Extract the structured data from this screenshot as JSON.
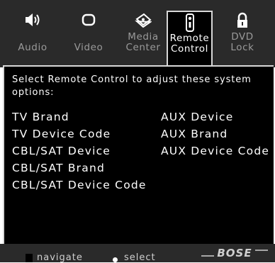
{
  "tabs": [
    {
      "label": "Audio",
      "icon": "speaker-icon",
      "active": false
    },
    {
      "label": "Video",
      "icon": "tv-screen-icon",
      "active": false
    },
    {
      "label": "Media\nCenter",
      "icon": "media-disc-icon",
      "active": false
    },
    {
      "label": "Remote\nControl",
      "icon": "remote-control-icon",
      "active": true
    },
    {
      "label": "DVD\nLock",
      "icon": "padlock-icon",
      "active": false
    }
  ],
  "intro": "Select Remote Control to adjust these system options:",
  "options_left": [
    "TV Brand",
    "TV Device Code",
    "CBL/SAT Device",
    "CBL/SAT Brand",
    "CBL/SAT Device Code"
  ],
  "options_right": [
    "AUX Device",
    "AUX Brand",
    "AUX Device Code"
  ],
  "hints": {
    "navigate": "navigate",
    "select": "select"
  },
  "brand": "BOSE",
  "colors": {
    "bar": "#2a2a2a",
    "panel": "#000000",
    "text": "#ffffff",
    "inactive": "#9a9a9a"
  }
}
